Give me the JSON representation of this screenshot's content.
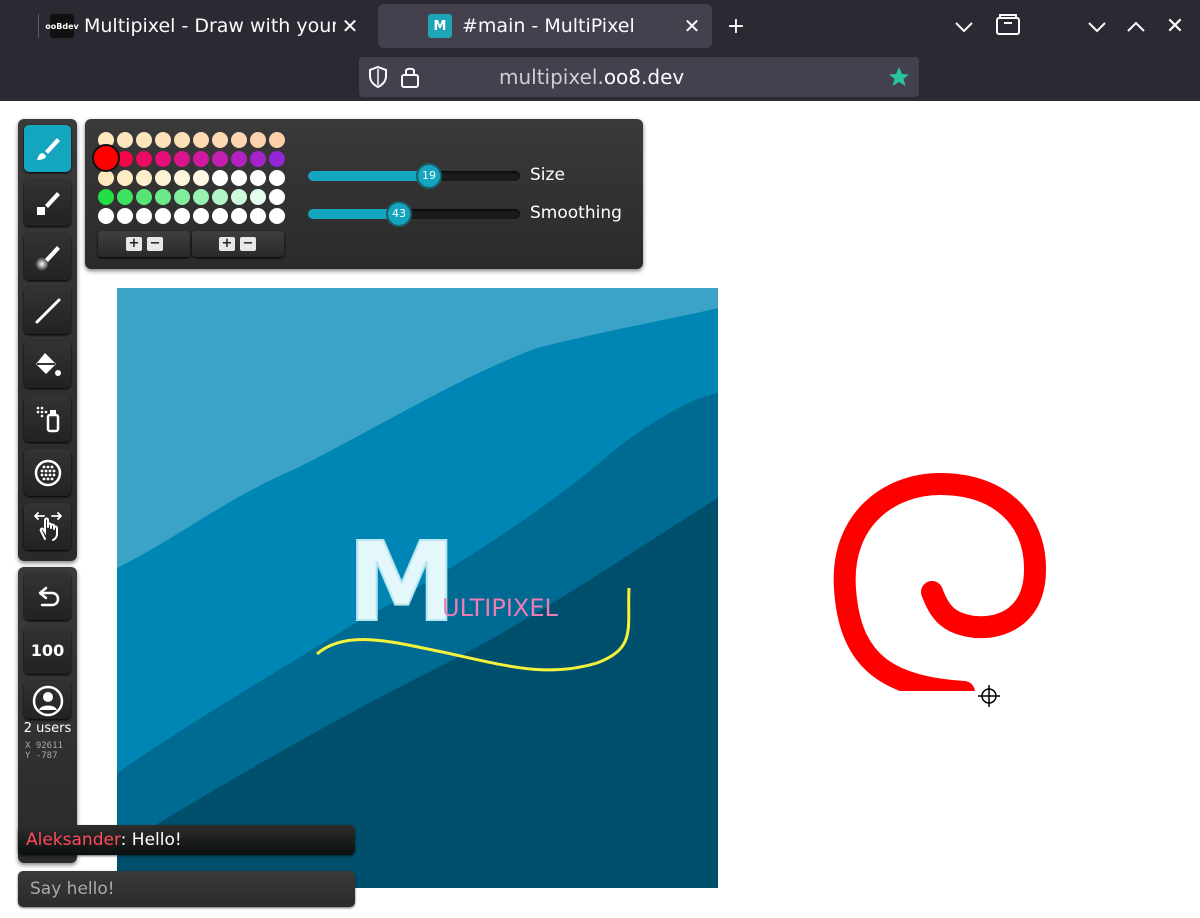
{
  "browser": {
    "tabs": [
      {
        "title": "Multipixel - Draw with your",
        "favicon_label": "ooBdev",
        "active": false
      },
      {
        "title": "#main - MultiPixel",
        "favicon_label": "M",
        "active": true
      }
    ],
    "new_tab_label": "+",
    "url_domain": "multipixel.",
    "url_host": "oo8.dev",
    "colors": {
      "chrome_bg": "#2b2a33",
      "active_tab": "#42414d",
      "star": "#2ac3a2"
    }
  },
  "toolbar": {
    "tools": [
      {
        "name": "brush-icon",
        "active": true
      },
      {
        "name": "eraser-icon",
        "active": false
      },
      {
        "name": "soft-brush-icon",
        "active": false
      },
      {
        "name": "line-icon",
        "active": false
      },
      {
        "name": "fill-bucket-icon",
        "active": false
      },
      {
        "name": "spray-icon",
        "active": false
      },
      {
        "name": "pattern-icon",
        "active": false
      },
      {
        "name": "hand-pan-icon",
        "active": false
      }
    ],
    "undo_icon": "undo-icon",
    "zoom_label": "100",
    "users_label": "2 users",
    "coord_x": "X  92611",
    "coord_y": "Y   -787"
  },
  "palette": {
    "selected_color": "#ff0000",
    "rows": [
      [
        "#fde9bd",
        "#fde6bc",
        "#fde4ba",
        "#fde1b8",
        "#fddfb6",
        "#fddcb4",
        "#fdd9b2",
        "#fdd6b0",
        "#fdd3ad",
        "#fdd0aa"
      ],
      [
        "#ff0000",
        "#f5054a",
        "#ee0a62",
        "#e60f78",
        "#dc148c",
        "#d0199e",
        "#c31eaf",
        "#b421be",
        "#a423cb",
        "#9326d6"
      ],
      [
        "#fde9bd",
        "#fdecc4",
        "#fdefcc",
        "#fef2d4",
        "#fef5dc",
        "#fef8e4",
        "#ffffff",
        "#ffffff",
        "#ffffff",
        "#ffffff"
      ],
      [
        "#22dd44",
        "#3fe25f",
        "#57e676",
        "#6cea8a",
        "#80ed9c",
        "#98f1b0",
        "#b4f5c8",
        "#cff9dd",
        "#e6fcee",
        "#ffffff"
      ],
      [
        "#ffffff",
        "#ffffff",
        "#ffffff",
        "#ffffff",
        "#ffffff",
        "#ffffff",
        "#ffffff",
        "#ffffff",
        "#ffffff",
        "#ffffff"
      ]
    ],
    "plus_label": "+",
    "minus_label": "−"
  },
  "sliders": {
    "size": {
      "label": "Size",
      "value": 19,
      "fraction": 0.57
    },
    "smoothing": {
      "label": "Smoothing",
      "value": 43,
      "fraction": 0.43
    }
  },
  "canvas": {
    "logo_letter": "M",
    "logo_text": "ULTIPIXEL",
    "colors": {
      "band1": "#3ba3c8",
      "band2": "#0086b4",
      "band3": "#006b92",
      "band4": "#004f6c",
      "stroke_red": "#ff0000",
      "stroke_yellow": "#f4f23a",
      "logo_pink": "#ee7ab6"
    }
  },
  "chat": {
    "author": "Aleksander",
    "message": ": Hello!",
    "author_color": "#ff4a5c",
    "input_placeholder": "Say hello!"
  }
}
